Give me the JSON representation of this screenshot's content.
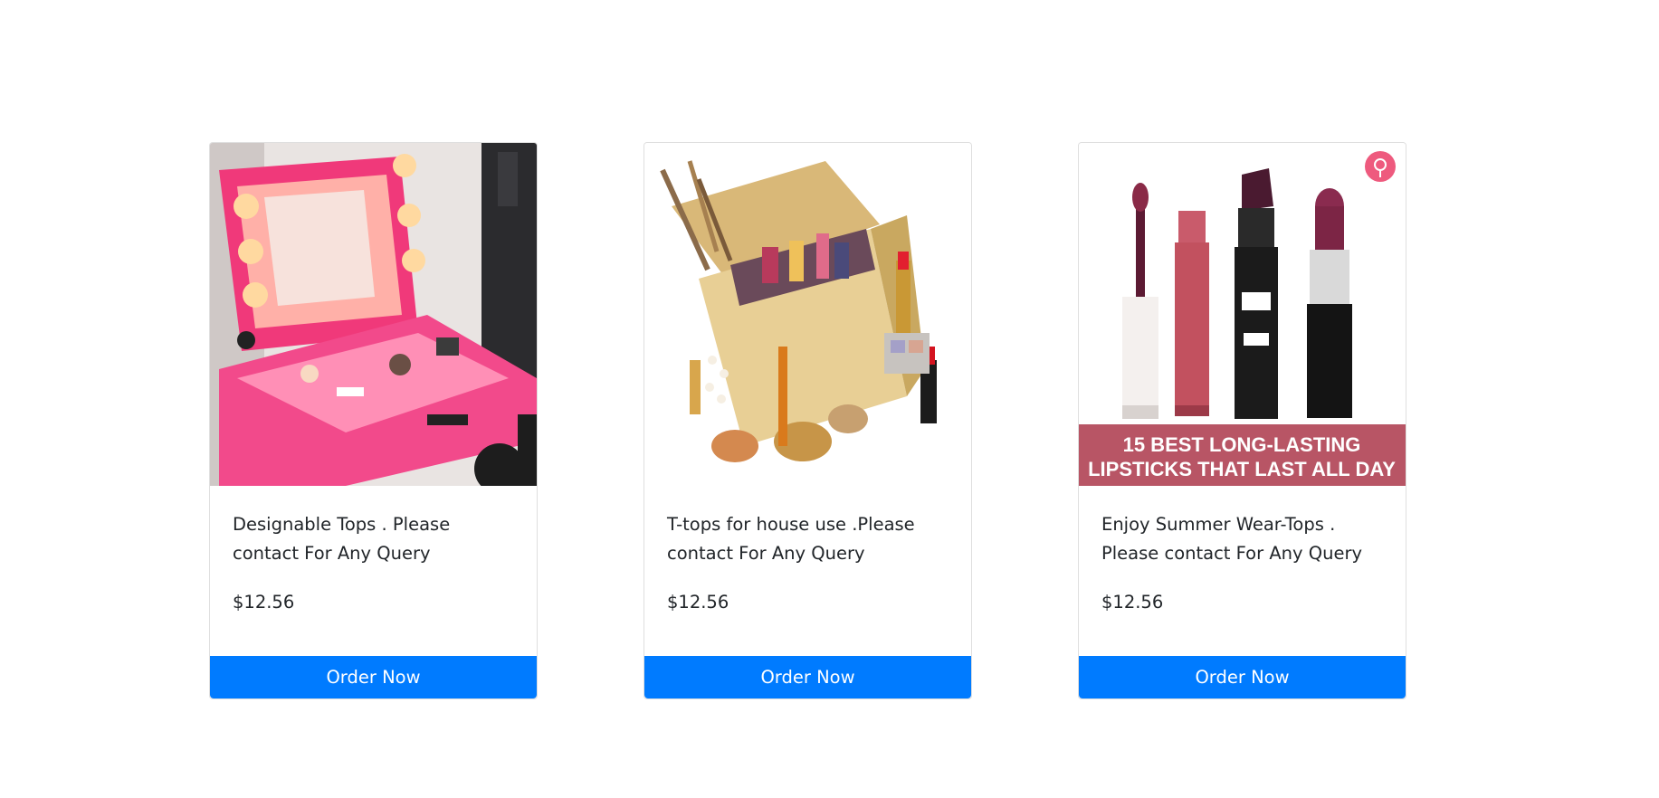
{
  "colors": {
    "accent": "#007bff",
    "text": "#212529",
    "card_border": "#dfdfdf"
  },
  "products": [
    {
      "description": "Designable Tops . Please contact For Any Query",
      "price": "$12.56",
      "button_label": "Order Now",
      "image_icon": "pink-makeup-vanity-case-image"
    },
    {
      "description": "T-tops for house use .Please contact For Any Query",
      "price": "$12.56",
      "button_label": "Order Now",
      "image_icon": "golden-cosmetics-box-image"
    },
    {
      "description": "Enjoy Summer Wear-Tops . Please contact For Any Query",
      "price": "$12.56",
      "button_label": "Order Now",
      "image_icon": "lipsticks-image",
      "image_caption_line1": "15 BEST LONG-LASTING",
      "image_caption_line2": "LIPSTICKS THAT LAST ALL DAY"
    }
  ]
}
